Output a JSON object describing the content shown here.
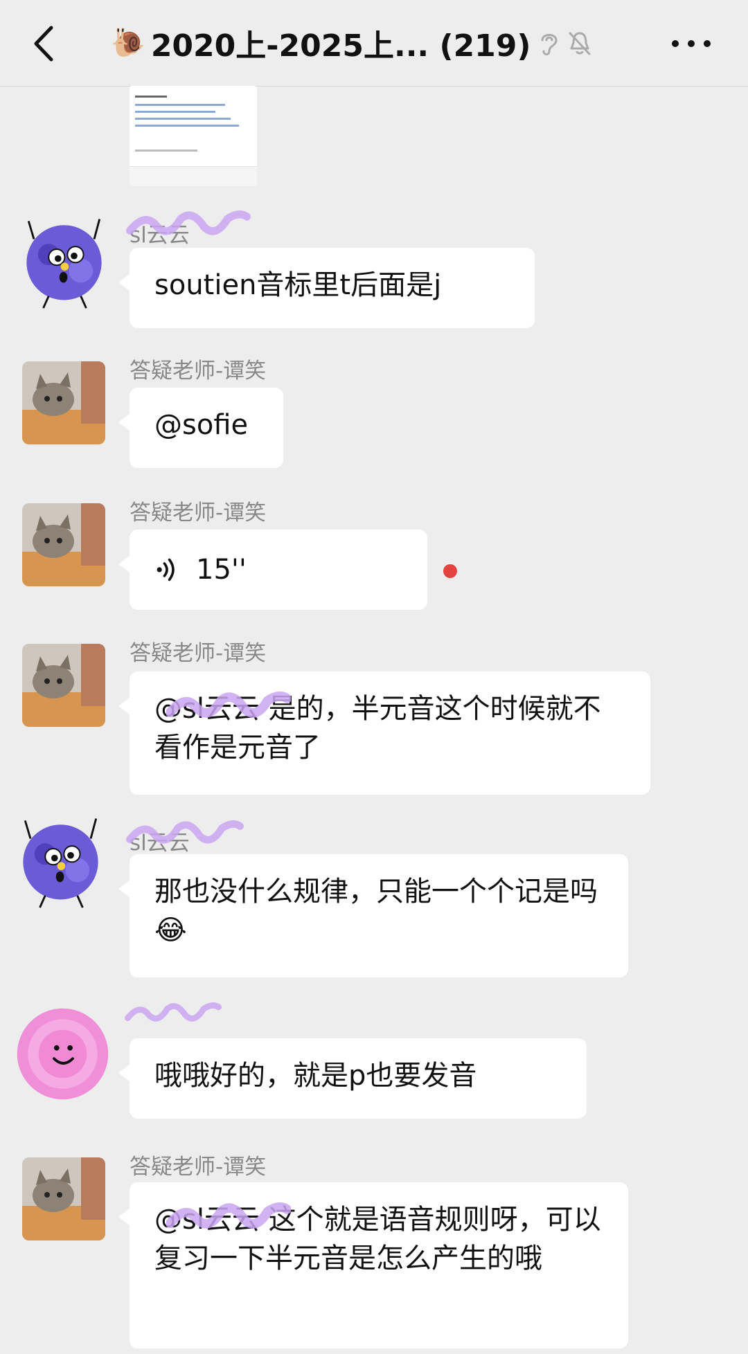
{
  "header": {
    "title": "2020上-2025上... (219)",
    "snail_icon": "🐌",
    "icons": [
      "back-chevron-icon",
      "ear-icon",
      "mute-bell-icon",
      "more-icon"
    ]
  },
  "messages": [
    {
      "sender": "sl云云",
      "text": "soutien音标里t后面是j",
      "avatar": "purple-scribble-avatar"
    },
    {
      "sender": "答疑老师-谭笑",
      "text": "@sofie",
      "avatar": "cat-photo-avatar"
    },
    {
      "sender": "答疑老师-谭笑",
      "voice_duration": "15''",
      "avatar": "cat-photo-avatar"
    },
    {
      "sender": "答疑老师-谭笑",
      "text": "@sl云云 是的，半元音这个时候就不看作是元音了",
      "avatar": "cat-photo-avatar"
    },
    {
      "sender": "sl云云",
      "text": "那也没什么规律，只能一个个记是吗😂",
      "avatar": "purple-scribble-avatar"
    },
    {
      "sender": "",
      "text": "哦哦好的，就是p也要发音",
      "avatar": "pink-scribble-avatar"
    },
    {
      "sender": "答疑老师-谭笑",
      "text": "@sl云云 这个就是语音规则呀，可以复习一下半元音是怎么产生的哦",
      "avatar": "cat-photo-avatar"
    }
  ],
  "colors": {
    "background": "#ededed",
    "bubble": "#ffffff",
    "redacted": "#c9a6f2",
    "unread_dot": "#e64340"
  }
}
